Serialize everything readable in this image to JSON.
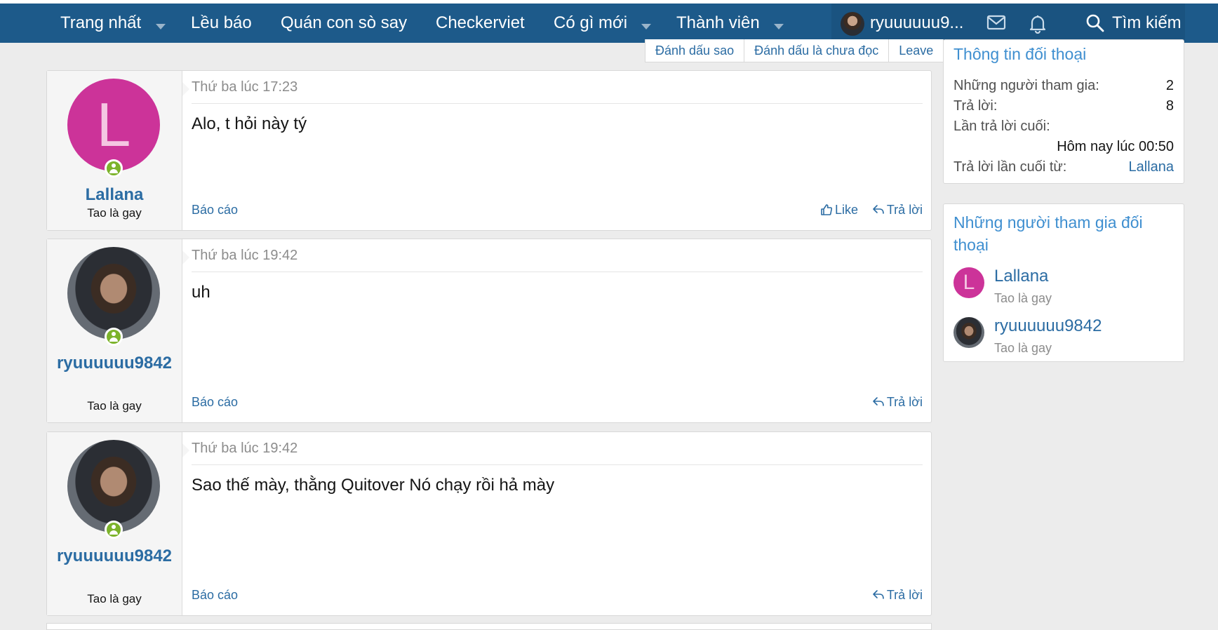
{
  "nav": {
    "items": [
      {
        "label": "Trang nhất",
        "has_dropdown": true
      },
      {
        "label": "Lều báo",
        "has_dropdown": false
      },
      {
        "label": "Quán con sò say",
        "has_dropdown": false
      },
      {
        "label": "Checkerviet",
        "has_dropdown": false
      },
      {
        "label": "Có gì mới",
        "has_dropdown": true
      },
      {
        "label": "Thành viên",
        "has_dropdown": true
      }
    ],
    "user_name": "ryuuuuuu9...",
    "search_label": "Tìm kiếm",
    "icons": [
      "mail-icon",
      "bell-icon",
      "search-icon"
    ]
  },
  "conversation_actions": [
    "Đánh dấu sao",
    "Đánh dấu là chưa đọc",
    "Leave"
  ],
  "messages": [
    {
      "date": "Thứ ba lúc 17:23",
      "text": "Alo, t hỏi này tý",
      "user": "Lallana",
      "user_title": "Tao là gay",
      "avatar_letter": "L",
      "report": "Báo cáo",
      "like": "Like",
      "reply": "Trả lời"
    },
    {
      "date": "Thứ ba lúc 19:42",
      "text": "uh",
      "user": "ryuuuuuu9842",
      "user_title": "Tao là gay",
      "report": "Báo cáo",
      "reply": "Trả lời"
    },
    {
      "date": "Thứ ba lúc 19:42",
      "text": "Sao thế mày, thằng Quitover Nó chạy rồi hả mày",
      "user": "ryuuuuuu9842",
      "user_title": "Tao là gay",
      "report": "Báo cáo",
      "reply": "Trả lời"
    }
  ],
  "info": {
    "title": "Thông tin đối thoại",
    "participants_label": "Những người tham gia:",
    "participants_value": "2",
    "replies_label": "Trả lời:",
    "replies_value": "8",
    "last_reply_label": "Lần trả lời cuối:",
    "last_reply_value": "Hôm nay lúc 00:50",
    "last_reply_by_label": "Trả lời lần cuối từ:",
    "last_reply_by_value": "Lallana"
  },
  "participants": {
    "title": "Những người tham gia đối thoại",
    "list": [
      {
        "name": "Lallana",
        "title": "Tao là gay",
        "avatar_letter": "L"
      },
      {
        "name": "ryuuuuuu9842",
        "title": "Tao là gay"
      }
    ]
  },
  "colors": {
    "nav_bg": "#1d5a8a",
    "link": "#2b6ca3",
    "accent_title": "#3f8fd0",
    "avatar_lallana": "#cc3399",
    "online": "#7cb32b",
    "page_bg": "#ececec"
  }
}
